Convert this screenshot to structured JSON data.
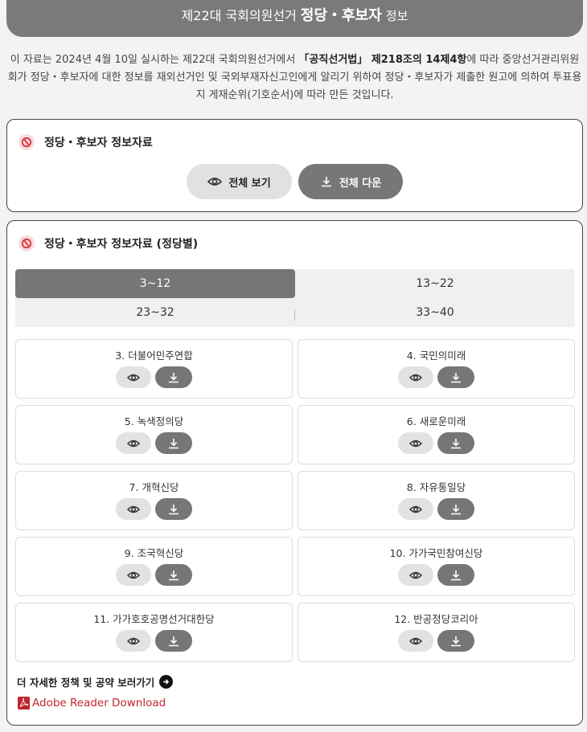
{
  "header": {
    "part1": "제22대 국회의원선거",
    "part2": "정당・후보자",
    "part3": "정보"
  },
  "intro": {
    "text_a": "이 자료는 2024년 4월 10일 실시하는 제22대 국회의원선거에서 ",
    "text_bold": "「공직선거법」 제218조의 14제4항",
    "text_b": "에 따라 중앙선거관리위원회가 정당・후보자에 대한 정보를 재외선거인 및 국외부재자신고인에게 알리기 위하여 정당・후보자가 제출한 원고에 의하여 투표용지 게재순위(기호순서)에 따라 만든 것입니다."
  },
  "all_section": {
    "title": "정당・후보자 정보자료",
    "view_all_label": "전체 보기",
    "download_all_label": "전체 다운"
  },
  "party_section": {
    "title": "정당・후보자 정보자료 (정당별)",
    "tabs": [
      "3~12",
      "13~22",
      "23~32",
      "33~40"
    ],
    "active_tab": "3~12",
    "parties": [
      {
        "name": "3. 더불어민주연합"
      },
      {
        "name": "4. 국민의미래"
      },
      {
        "name": "5. 녹색정의당"
      },
      {
        "name": "6. 새로운미래"
      },
      {
        "name": "7. 개혁신당"
      },
      {
        "name": "8. 자유통일당"
      },
      {
        "name": "9. 조국혁신당"
      },
      {
        "name": "10. 가가국민참여신당"
      },
      {
        "name": "11. 가가호호공명선거대한당"
      },
      {
        "name": "12. 반공정당코리아"
      }
    ],
    "more_link": "더 자세한 정책 및 공약 보러가기",
    "adobe_link": "Adobe Reader Download"
  },
  "colors": {
    "header_bg": "#7a7a7c",
    "active_tab": "#767678",
    "adobe_red": "#c0262d"
  },
  "icons": {
    "ballot": "ballot-stamp-icon",
    "view": "eye-icon",
    "download": "download-icon",
    "arrow": "arrow-right-icon",
    "adobe": "adobe-pdf-icon"
  }
}
